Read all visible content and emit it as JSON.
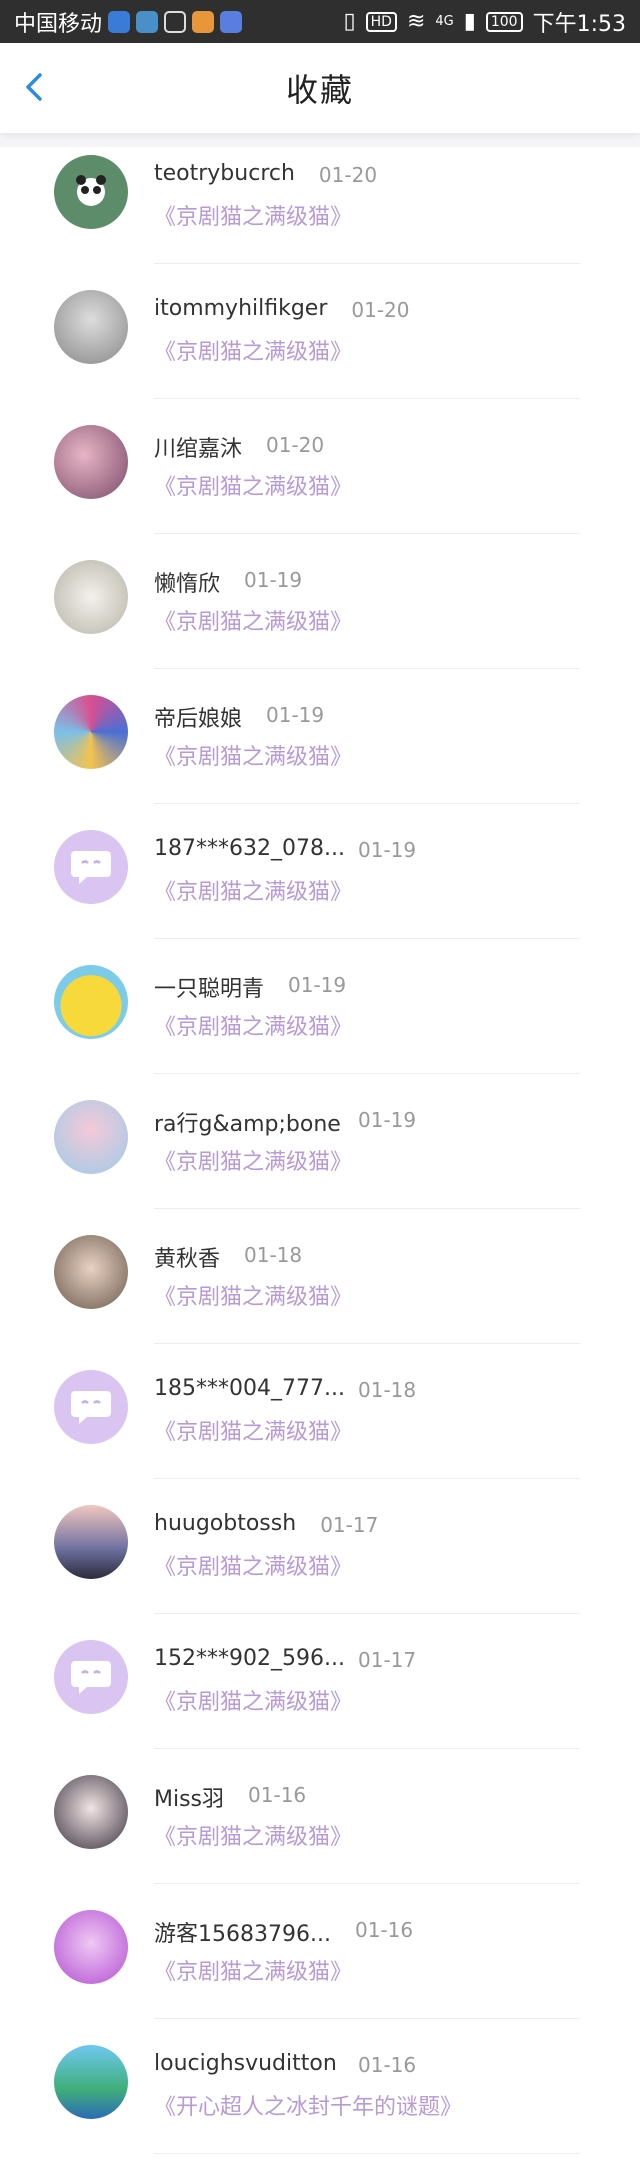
{
  "status_bar": {
    "carrier": "中国移动",
    "network": "4G",
    "battery": "100",
    "time": "下午1:53",
    "hd": "HD"
  },
  "header": {
    "title": "收藏"
  },
  "favorites": [
    {
      "name": "teotrybucrch",
      "date": "01-20",
      "work": "《京剧猫之满级猫》",
      "avatar": "panda"
    },
    {
      "name": "itommyhilfikger",
      "date": "01-20",
      "work": "《京剧猫之满级猫》",
      "avatar": "gray"
    },
    {
      "name": "川绾嘉沐",
      "date": "01-20",
      "work": "《京剧猫之满级猫》",
      "avatar": "pink"
    },
    {
      "name": "懒惰欣",
      "date": "01-19",
      "work": "《京剧猫之满级猫》",
      "avatar": "flowers"
    },
    {
      "name": "帝后娘娘",
      "date": "01-19",
      "work": "《京剧猫之满级猫》",
      "avatar": "anime"
    },
    {
      "name": "187***632_078...",
      "date": "01-19",
      "work": "《京剧猫之满级猫》",
      "avatar": "default"
    },
    {
      "name": "一只聪明青",
      "date": "01-19",
      "work": "《京剧猫之满级猫》",
      "avatar": "pikachu"
    },
    {
      "name": "ra行g&amp;bone",
      "date": "01-19",
      "work": "《京剧猫之满级猫》",
      "avatar": "girl"
    },
    {
      "name": "黄秋香",
      "date": "01-18",
      "work": "《京剧猫之满级猫》",
      "avatar": "photo"
    },
    {
      "name": "185***004_777...",
      "date": "01-18",
      "work": "《京剧猫之满级猫》",
      "avatar": "default"
    },
    {
      "name": "huugobtossh",
      "date": "01-17",
      "work": "《京剧猫之满级猫》",
      "avatar": "sunset"
    },
    {
      "name": "152***902_596...",
      "date": "01-17",
      "work": "《京剧猫之满级猫》",
      "avatar": "default"
    },
    {
      "name": "Miss羽",
      "date": "01-16",
      "work": "《京剧猫之满级猫》",
      "avatar": "dark"
    },
    {
      "name": "游客15683796...",
      "date": "01-16",
      "work": "《京剧猫之满级猫》",
      "avatar": "purple"
    },
    {
      "name": "loucighsvuditton",
      "date": "01-16",
      "work": "《开心超人之冰封千年的谜题》",
      "avatar": "scenery"
    }
  ]
}
